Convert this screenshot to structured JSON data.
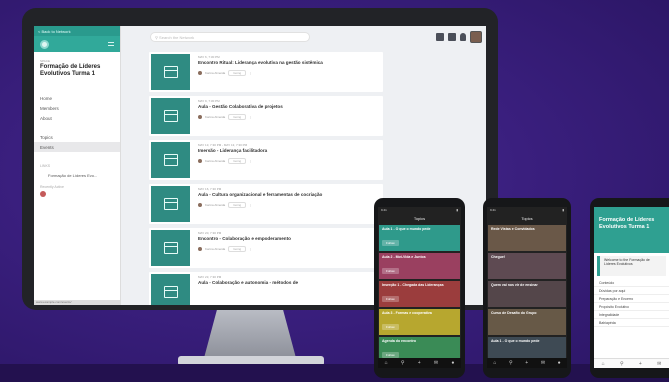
{
  "desktop": {
    "back_link": "< Back to Network",
    "search_placeholder": "Search the Network",
    "space_caption": "SPACE",
    "space_title": "Formação de Líderes Evolutivos Turma 1",
    "nav_items": [
      "Home",
      "Members",
      "About",
      "Topics",
      "Events"
    ],
    "active_nav": "Events",
    "groups_caption": "LINKS",
    "group_link": "Formação de Líderes Evo...",
    "members_caption": "Recently Active",
    "url_text": "www.example.com/events/",
    "events": [
      {
        "date": "MAY 6, 7:30 PM",
        "title": "Encontro Ritual: Liderança evolutiva na gestão sistêmica",
        "attendees": "Karina Almeida",
        "rsvp": "Going"
      },
      {
        "date": "MAY 9, 7:30 PM",
        "title": "Aula - Gestão Colaborativa de projetos",
        "attendees": "Karina Almeida",
        "rsvp": "Going"
      },
      {
        "date": "MAY 13, 7:30 PM - MAY 13, 7:30 PM",
        "title": "Imersão - Liderança facilitadora",
        "attendees": "Karina Almeida",
        "rsvp": "Going"
      },
      {
        "date": "MAY 16, 7:30 PM",
        "title": "Aula - Cultura organizacional e ferramentas de cocriação",
        "attendees": "Karina Almeida",
        "rsvp": "Going"
      },
      {
        "date": "MAY 20, 7:30 PM",
        "title": "Encontro - Colaboração e empoderamento",
        "attendees": "Karina Almeida",
        "rsvp": "Going"
      },
      {
        "date": "MAY 23, 7:30 PM",
        "title": "Aula - Colaboração e autonomia - métodos de",
        "attendees": "",
        "rsvp": ""
      }
    ]
  },
  "phone1": {
    "time": "9:41",
    "title": "Topics",
    "rows": [
      {
        "title": "Aula 1 - O que o mundo pede",
        "action": "Follow",
        "color": "#2f9a8b"
      },
      {
        "title": "Aula 2 - Mot-Vida e Juntos",
        "action": "Follow",
        "color": "#9a4060"
      },
      {
        "title": "Inserção 1 - Chegada das Lideranças",
        "action": "Follow",
        "color": "#9b3d3d"
      },
      {
        "title": "Aula 3 - Formas e cooperativa",
        "action": "Follow",
        "color": "#b7a72f"
      },
      {
        "title": "Agenda do encontro",
        "action": "Follow",
        "color": "#3a8b56"
      }
    ]
  },
  "phone2": {
    "time": "9:41",
    "title": "Topics",
    "rows": [
      {
        "title": "Rede Vistas e Convidados",
        "color": "#6a5848"
      },
      {
        "title": "Chegue!",
        "color": "#5e4a52"
      },
      {
        "title": "Quem vai nos vir de ensinar",
        "color": "#54464a"
      },
      {
        "title": "Curso de Desafio do Grupo",
        "color": "#675947"
      },
      {
        "title": "Aula 1 - O que o mundo pede",
        "color": "#3e4a54"
      }
    ]
  },
  "phone3": {
    "title": "Formação de Líderes Evolutivos Turma 1",
    "card_title": "Welcome to the Formação de Líderes Evolutivos",
    "items": [
      "Conteúdo",
      "Dúvidas por aqui",
      "Preparação e Encerro",
      "Propósito Evolutivo",
      "Integralidade",
      "Bahiapéda"
    ]
  }
}
